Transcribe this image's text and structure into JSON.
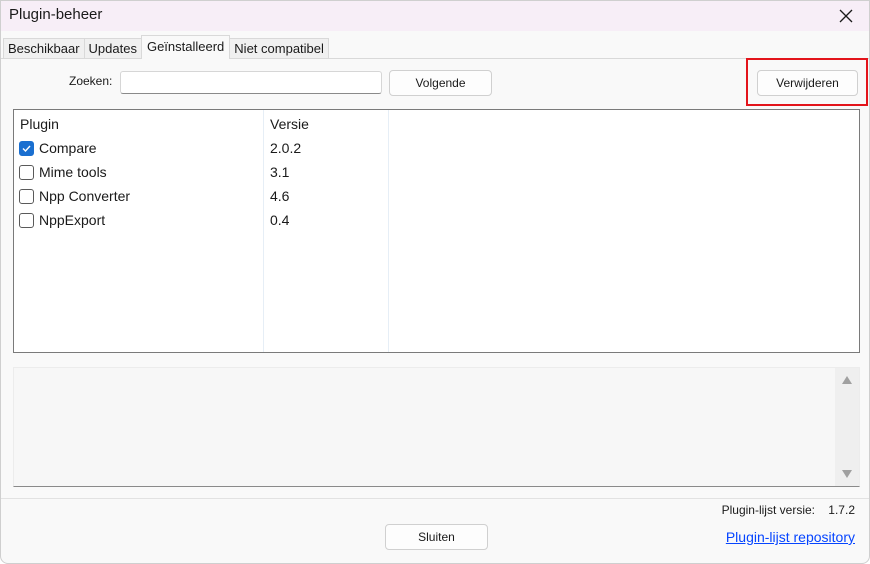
{
  "window": {
    "title": "Plugin-beheer",
    "close_icon": "close-icon"
  },
  "tabs": [
    {
      "label": "Beschikbaar",
      "active": false
    },
    {
      "label": "Updates",
      "active": false
    },
    {
      "label": "Geïnstalleerd",
      "active": true
    },
    {
      "label": "Niet compatibel",
      "active": false
    }
  ],
  "search": {
    "label": "Zoeken:",
    "value": "",
    "placeholder": ""
  },
  "buttons": {
    "next": "Volgende",
    "remove": "Verwijderen",
    "close": "Sluiten"
  },
  "list": {
    "columns": [
      "Plugin",
      "Versie"
    ],
    "rows": [
      {
        "name": "Compare",
        "version": "2.0.2",
        "checked": true
      },
      {
        "name": "Mime tools",
        "version": "3.1",
        "checked": false
      },
      {
        "name": "Npp Converter",
        "version": "4.6",
        "checked": false
      },
      {
        "name": "NppExport",
        "version": "0.4",
        "checked": false
      }
    ]
  },
  "description": {
    "text": ""
  },
  "footer": {
    "version_label": "Plugin-lijst versie:",
    "version_value": "1.7.2",
    "repo_link": "Plugin-lijst repository"
  },
  "colors": {
    "highlight": "#e3141b",
    "checkbox_accent": "#1a6fd0",
    "link": "#0645ff"
  }
}
